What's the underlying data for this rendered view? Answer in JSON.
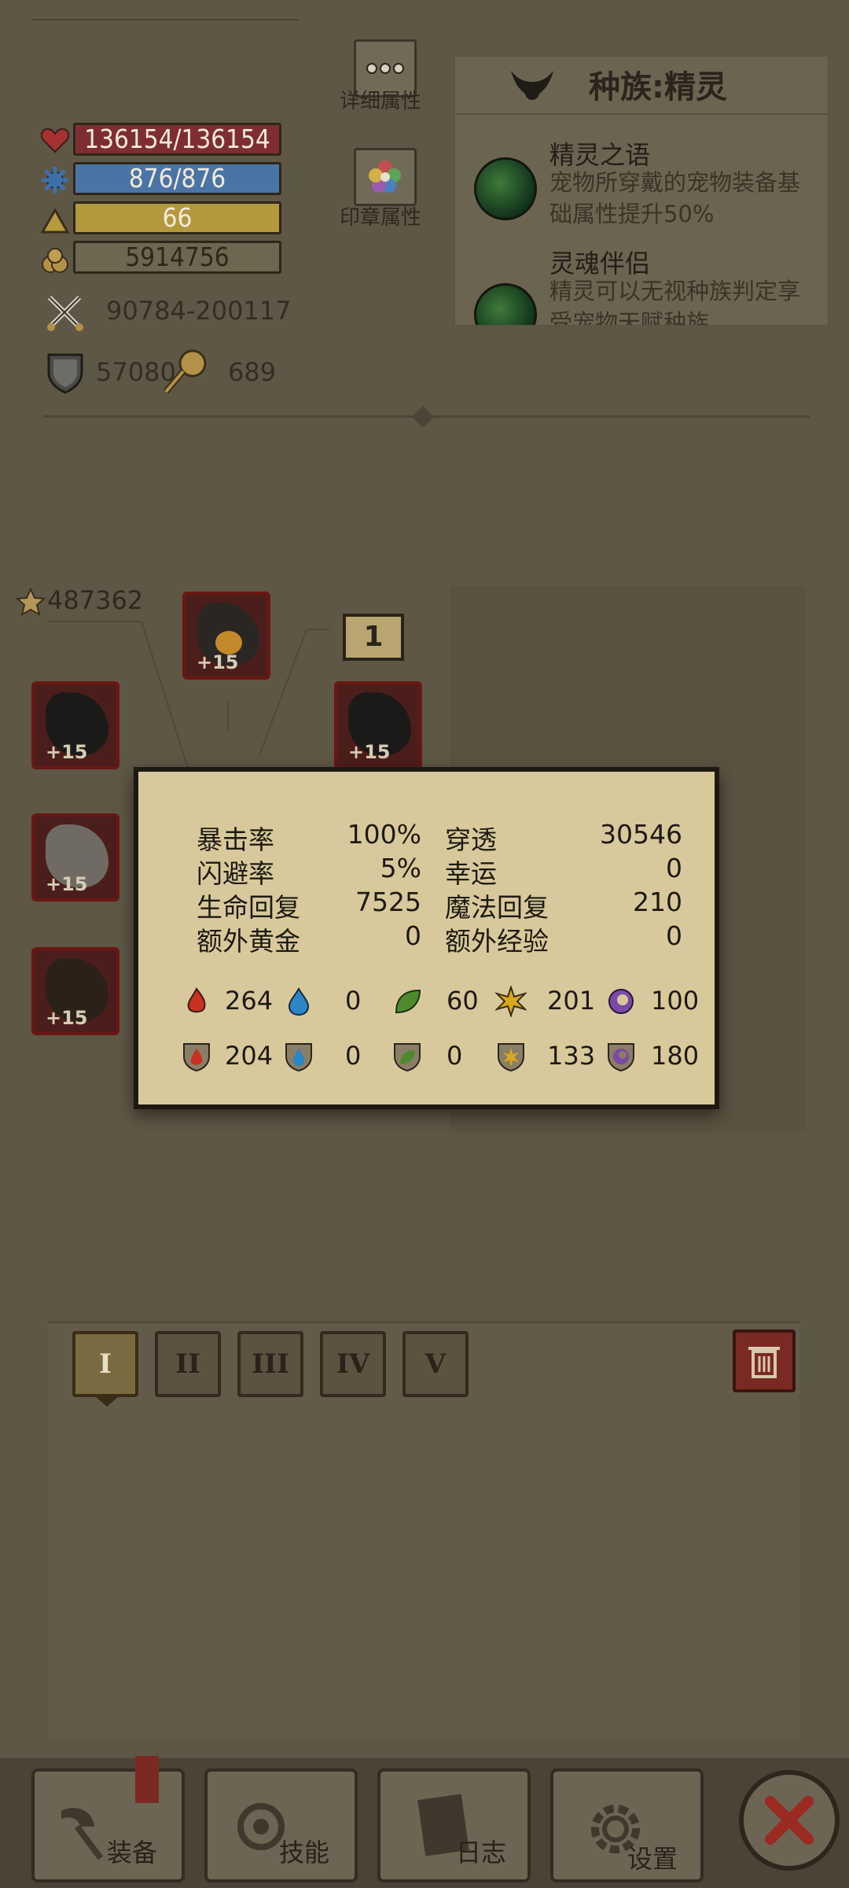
{
  "stats": {
    "hp": "136154/136154",
    "mp": "876/876",
    "level": "66",
    "gold": "5914756",
    "attack": "90784-200117",
    "defense": "57080",
    "resist": "689"
  },
  "top_buttons": {
    "detail_label": "详细属性",
    "seal_label": "印章属性"
  },
  "race": {
    "title": "种族:精灵",
    "traits": [
      {
        "name": "精灵之语",
        "desc": "宠物所穿戴的宠物装备基础属性提升50%"
      },
      {
        "name": "灵魂伴侣",
        "desc": "精灵可以无视种族判定享受宠物天赋种族"
      }
    ]
  },
  "equipment": {
    "score": "487362",
    "level_badge": "1",
    "plus_labels": [
      "+15",
      "+15",
      "+15",
      "+15",
      "+15"
    ]
  },
  "popup": {
    "rows": [
      {
        "l1": "暴击率",
        "v1": "100%",
        "l2": "穿透",
        "v2": "30546"
      },
      {
        "l1": "闪避率",
        "v1": "5%",
        "l2": "幸运",
        "v2": "0"
      },
      {
        "l1": "生命回复",
        "v1": "7525",
        "l2": "魔法回复",
        "v2": "210"
      },
      {
        "l1": "额外黄金",
        "v1": "0",
        "l2": "额外经验",
        "v2": "0"
      }
    ],
    "attack_elements": [
      "264",
      "0",
      "60",
      "201",
      "100"
    ],
    "resist_elements": [
      "204",
      "0",
      "0",
      "133",
      "180"
    ],
    "element_colors": {
      "fire": "#c8321f",
      "water": "#2a86c5",
      "nature": "#4e8a2c",
      "light": "#d9a81c",
      "dark": "#7a4aa8"
    }
  },
  "sets": {
    "tabs": [
      "I",
      "II",
      "III",
      "IV",
      "V"
    ],
    "active": 0
  },
  "nav": {
    "equip": "装备",
    "skill": "技能",
    "log": "日志",
    "settings": "设置"
  }
}
